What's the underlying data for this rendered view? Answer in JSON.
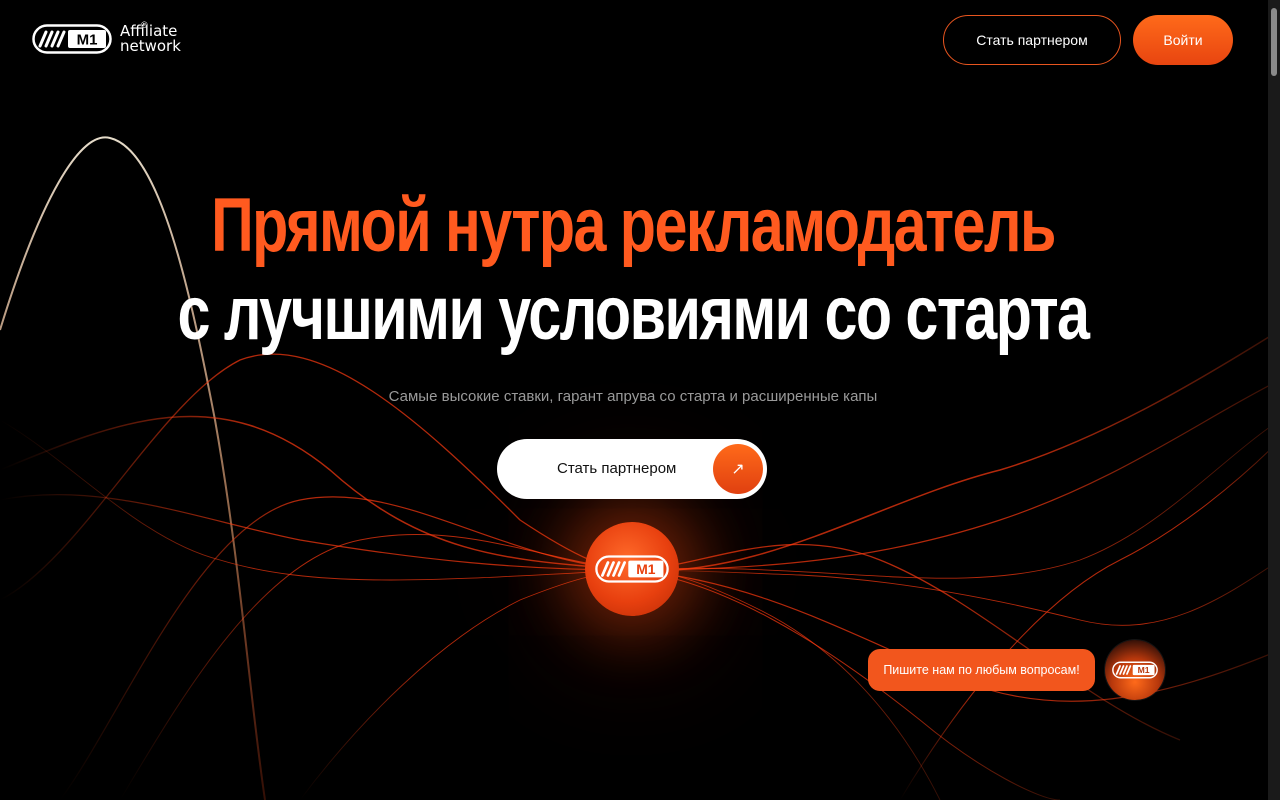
{
  "header": {
    "logo_text_line1": "Affiliate",
    "logo_text_line2": "network",
    "logo_registered": "®",
    "partner_button": "Стать партнером",
    "login_button": "Войти"
  },
  "hero": {
    "headline_line1": "Прямой нутра рекламодатель",
    "headline_line2": "с лучшими условиями со старта",
    "subtitle": "Самые высокие ставки, гарант апрува со старта и расширенные капы",
    "cta_label": "Стать партнером",
    "cta_arrow": "↗"
  },
  "chat": {
    "bubble_text": "Пишите нам по любым вопросам!"
  },
  "colors": {
    "accent": "#ff5a1f",
    "background": "#000000",
    "text_primary": "#ffffff",
    "text_muted": "#9a9a9a"
  },
  "icons": {
    "logo": "m1-logo-icon",
    "cta_arrow": "arrow-up-right-icon",
    "center_orb": "m1-logo-icon",
    "chat_avatar": "m1-logo-icon"
  }
}
